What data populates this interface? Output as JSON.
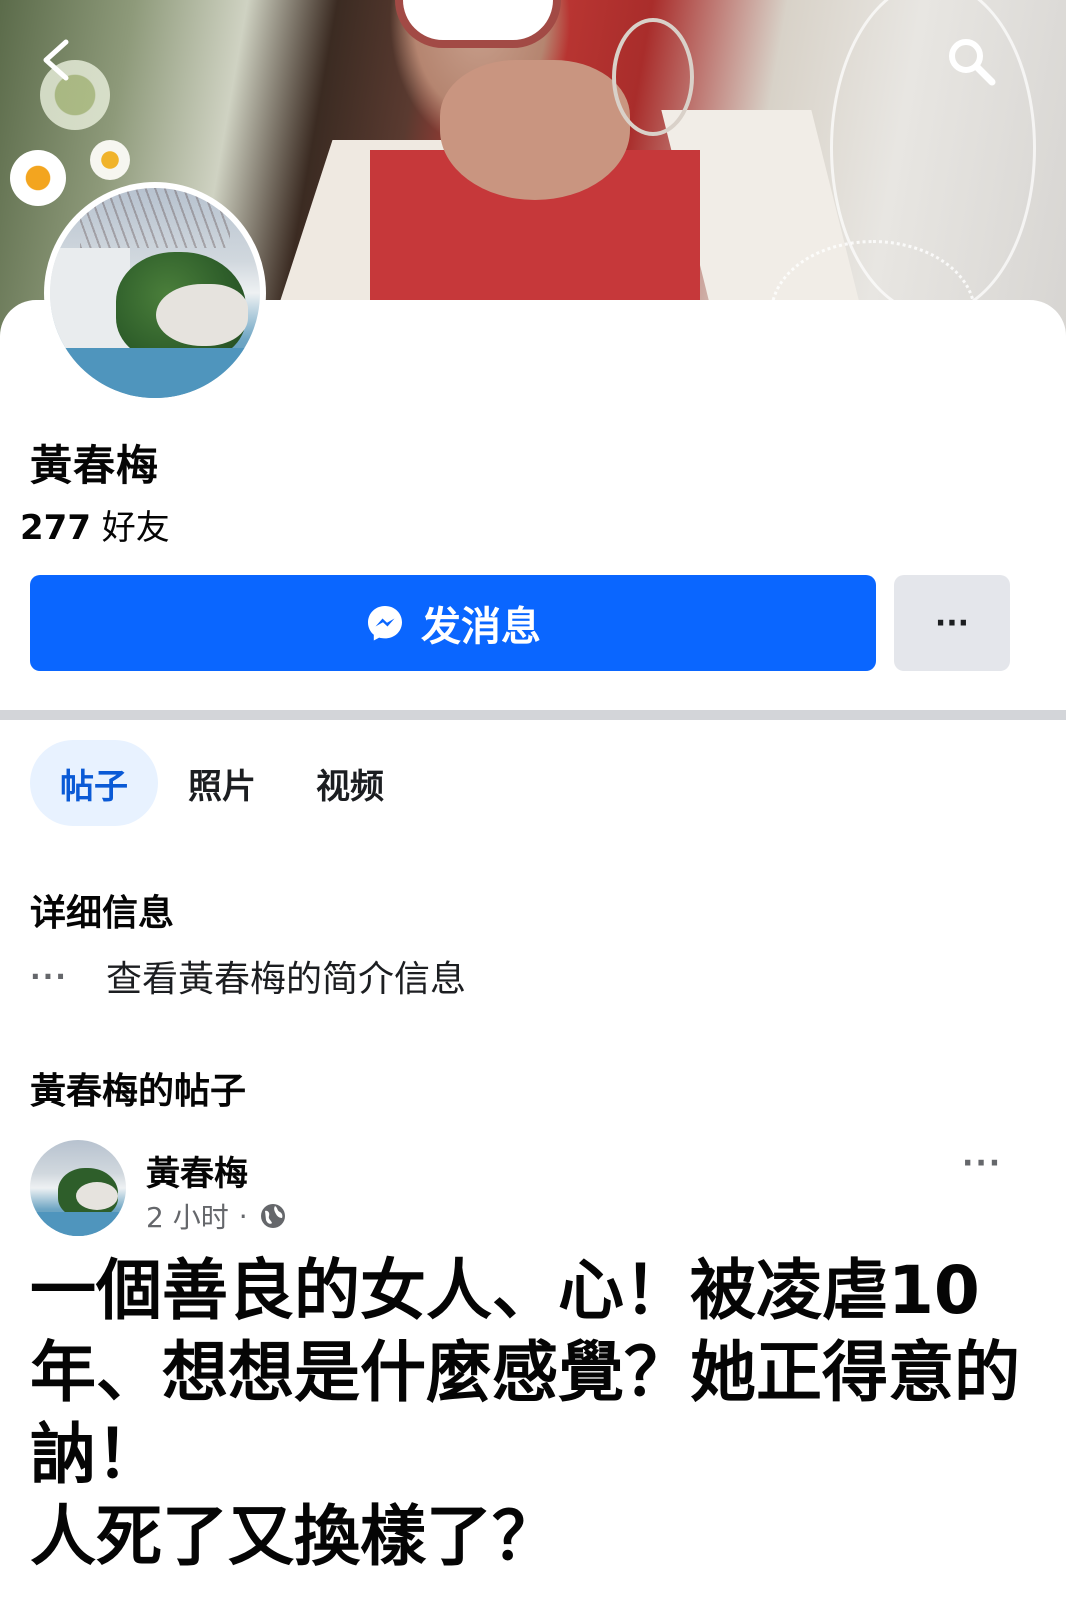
{
  "header": {
    "back_icon": "chevron-left-icon",
    "search_icon": "search-icon"
  },
  "profile": {
    "name": "黃春梅",
    "friends_count": "277",
    "friends_label": "好友"
  },
  "actions": {
    "message_label": "发消息",
    "message_icon": "messenger-icon",
    "more_label": "···"
  },
  "tabs": [
    {
      "label": "帖子",
      "active": true
    },
    {
      "label": "照片",
      "active": false
    },
    {
      "label": "视频",
      "active": false
    }
  ],
  "details": {
    "title": "详细信息",
    "row_icon": "···",
    "row_text": "查看黃春梅的简介信息"
  },
  "posts": {
    "title": "黃春梅的帖子",
    "items": [
      {
        "author": "黃春梅",
        "time": "2 小时",
        "separator": "·",
        "privacy_icon": "globe-icon",
        "more": "···",
        "text": "一個善良的女人、心！被凌虐10\n年、想想是什麼感覺？她正得意的\n訥！\n人死了又換樣了？"
      }
    ]
  },
  "colors": {
    "accent": "#0a66ff",
    "tab_active_bg": "#e8f2ff",
    "secondary_button": "#e4e6eb",
    "muted_text": "#65676b"
  }
}
